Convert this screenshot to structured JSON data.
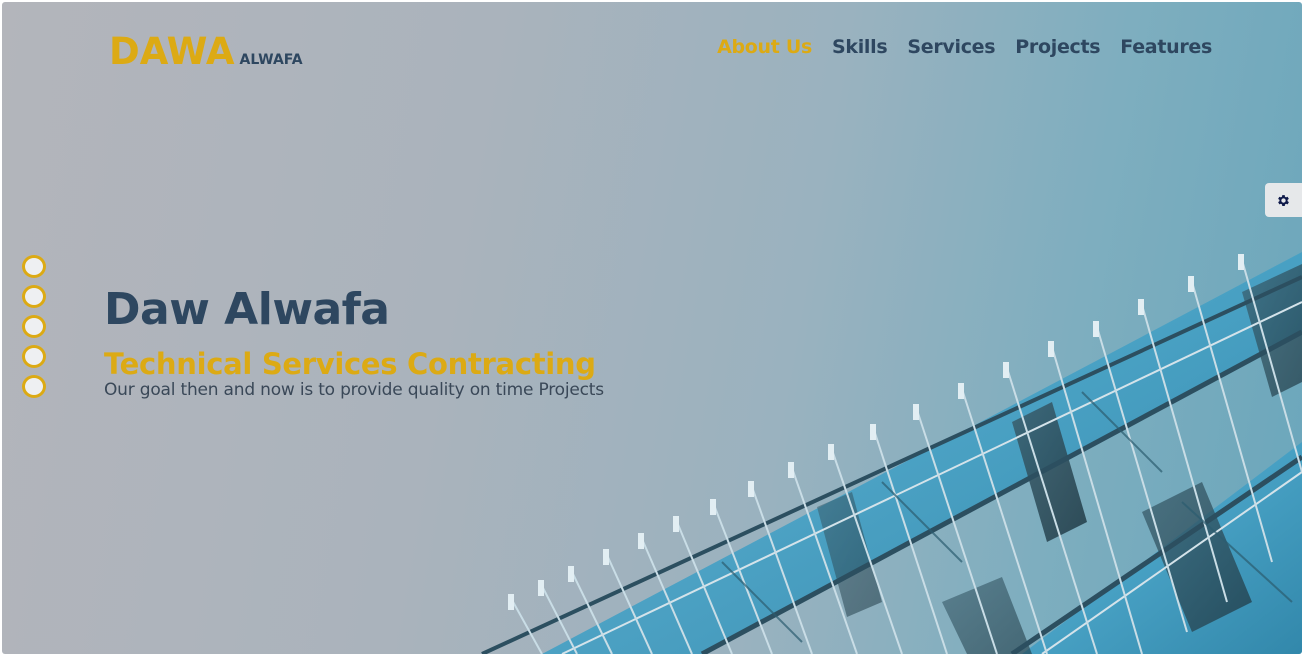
{
  "header": {
    "logo_main": "DAWA",
    "logo_sub": "ALWAFA",
    "nav": [
      {
        "label": "About Us",
        "active": true
      },
      {
        "label": "Skills",
        "active": false
      },
      {
        "label": "Services",
        "active": false
      },
      {
        "label": "Projects",
        "active": false
      },
      {
        "label": "Features",
        "active": false
      }
    ]
  },
  "hero": {
    "title": "Daw Alwafa",
    "subtitle": "Technical Services Contracting",
    "description": "Our goal then and now is to provide quality on time Projects"
  },
  "slider": {
    "bullet_count": 5
  },
  "settings": {
    "icon": "gear-icon"
  },
  "colors": {
    "accent": "#dcaa14",
    "primary_text": "#2e4760",
    "glass": "#4aa3c4"
  }
}
